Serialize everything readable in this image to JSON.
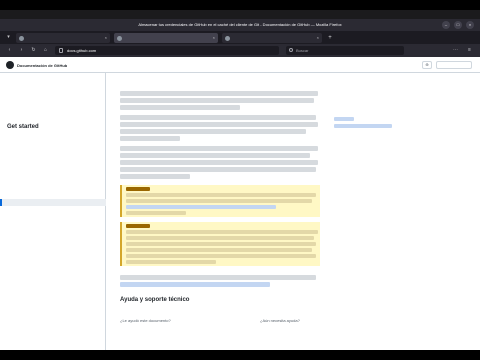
{
  "browser": {
    "window_title": "Almacenar tus credenciales de GitHub en el caché del cliente de Git - Documentación de GitHub — Mozilla Firefox",
    "clock": "",
    "activities_label": "",
    "tabs": [
      {
        "label": "",
        "active": false
      },
      {
        "label": "",
        "active": true
      },
      {
        "label": "",
        "active": false
      }
    ],
    "url_host": "docs.github.com",
    "url_rest": "",
    "search_placeholder": "Buscar"
  },
  "site": {
    "name": "Documentación de GitHub",
    "version": ""
  },
  "sidebar": {
    "home_link": "",
    "section_title": "Get started",
    "items": []
  },
  "article": {
    "help_heading": "Ayuda y soporte técnico",
    "help_left": "¿Le ayudó este documento?",
    "help_right": "¿Aún necesita ayuda?"
  },
  "right_panel": {
    "heading": ""
  },
  "colors": {
    "link": "#0969da",
    "note_background": "#fff8c5",
    "note_border": "#d4a72c",
    "browser_chrome": "#2b2a33"
  }
}
